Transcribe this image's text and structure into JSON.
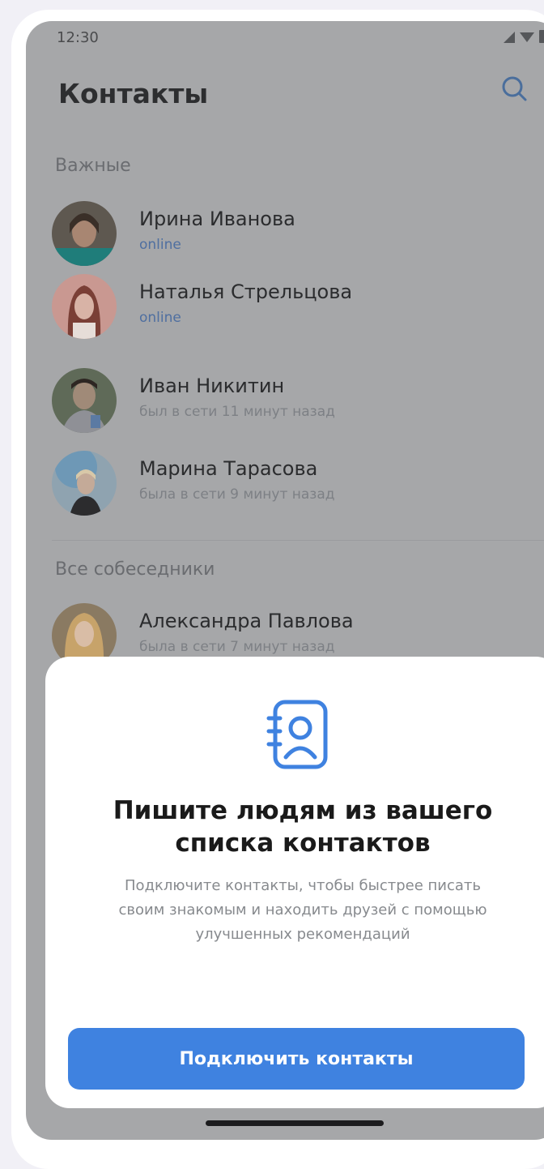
{
  "status_bar": {
    "time": "12:30"
  },
  "header": {
    "title": "Контакты",
    "search_icon": "search-icon"
  },
  "sections": {
    "important": "Важные",
    "all": "Все собеседники"
  },
  "important_contacts": [
    {
      "name": "Ирина Иванова",
      "status": "online"
    },
    {
      "name": "Наталья Стрельцова",
      "status": "online"
    },
    {
      "name": "Иван Никитин",
      "status": "был в сети 11 минут назад"
    },
    {
      "name": "Марина Тарасова",
      "status": "была в сети 9 минут назад"
    }
  ],
  "all_contacts": [
    {
      "name": "Александра Павлова",
      "status": "была в сети 7 минут назад"
    }
  ],
  "sheet": {
    "icon": "address-book-icon",
    "title": "Пишите людям из вашего списка контактов",
    "description": "Подключите контакты, чтобы быстрее писать своим знакомым и находить друзей с помощью улучшенных рекомендаций",
    "button_label": "Подключить контакты"
  },
  "colors": {
    "accent": "#3f82e0",
    "online": "#4f6fa0",
    "overlay": "#a6a7a9"
  }
}
